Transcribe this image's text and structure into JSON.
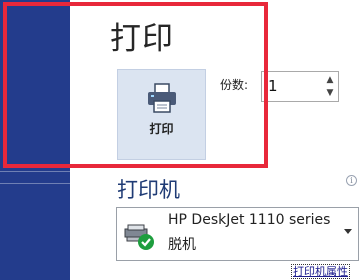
{
  "backstage": {
    "title": "打印",
    "print_button_label": "打印",
    "print_button_icon": "printer-icon"
  },
  "copies": {
    "label": "份数:",
    "value": "1"
  },
  "printer": {
    "heading": "打印机",
    "info_icon": "info-icon",
    "selected_name": "HP DeskJet 1110 series",
    "selected_status": "脱机",
    "device_icon": "printer-offline-icon",
    "properties_link": "打印机属性"
  },
  "colors": {
    "sidebar": "#233c8c",
    "highlight": "#e8283a",
    "heading": "#1f3b75",
    "button_bg": "#dbe4f1"
  }
}
